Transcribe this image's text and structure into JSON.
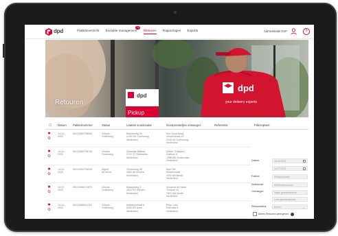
{
  "nav": {
    "logo_text": "dpd",
    "items": [
      {
        "label": "Pakketoverzicht",
        "active": false
      },
      {
        "label": "Exceptie management",
        "active": false,
        "badge": "12"
      },
      {
        "label": "Retouren",
        "active": true
      },
      {
        "label": "Rapportages",
        "active": false
      },
      {
        "label": "Exports",
        "active": false
      }
    ],
    "user": "Administratie DVP",
    "help": "?"
  },
  "hero": {
    "title": "Retouren",
    "shirt_brand": "dpd",
    "shirt_slogan": "your delivery experts",
    "shop_sign": "dpd",
    "shop_sign_sub": "Pickup"
  },
  "table": {
    "columns": [
      "Datum",
      "Pakketnummer",
      "Status",
      "Laatste scanlocatie",
      "Oorspronkelijke ontvanger",
      "Referentie"
    ],
    "rows": [
      {
        "datum": "14-01-\n2020",
        "pakket": "05123089738854",
        "status": "Ontvan\nOnderweg",
        "scan": "Bakkerweg 25\n4105 NH Culemborg\nNederland",
        "ontvanger": "Kim Gevenberg\nVlinderstraat 23\n4105 NL Culemborg\nNederland",
        "referentie": ""
      },
      {
        "datum": "14-01-\n2020",
        "pakket": "05123089738705",
        "status": "Ontvan\nOnderweg",
        "scan": "Zwaantje Bijlsma\n3712 ST Rotterdam\nNederland",
        "ontvanger": "Esther Tresbijker\nDuifhuis 6\n1388 MK Amsterdam\nNederland",
        "referentie": ""
      },
      {
        "datum": "14-01-\n2020",
        "pakket": "05123094796325",
        "status": "Afgele\nbij retour",
        "scan": "Vlinderweg 35\n3452 AB Almere\nNederland",
        "ontvanger": "Boef Vel\nMulderstraat\n4002 AB Breda\nNederland",
        "referentie": ""
      },
      {
        "datum": "14-01-\n2020",
        "pakket": "05123098274879",
        "status": "Ontvan\nOnderweg",
        "scan": "Klaasjeweg 3\n4302 KX Vlijmen\nNederland",
        "ontvanger": "Suzanne de Haan\nTuinpad 24\n7821 DA Zwolle\nNederland",
        "referentie": ""
      },
      {
        "datum": "14-01-\n2020",
        "pakket": "05123086541152",
        "status": "Ontvan\nOnderweg",
        "scan": "Kastanjestraat 8\n5400 BS Uden\nNederland",
        "ontvanger": "Peter Lam\nDriehoek 8\nNederland",
        "referentie": ""
      }
    ]
  },
  "filter": {
    "title": "Filteropties",
    "fields": [
      {
        "label": "Datum",
        "value": "16-06-2022",
        "icon": "calendar-icon"
      },
      {
        "label": "",
        "value": "16-07-2022",
        "icon": "calendar-icon"
      },
      {
        "label": "Pakket",
        "value": "Pakketnummer",
        "icon": ""
      },
      {
        "label": "Referentie",
        "value": "Referentienummer",
        "icon": ""
      },
      {
        "label": "Ontvanger",
        "value": "Naam geadresseerde",
        "icon": ""
      },
      {
        "label": "",
        "value": "Land geadresseerde",
        "icon": ""
      },
      {
        "label": "Retourstatus",
        "value": "Kiezen",
        "icon": "chevron-down-icon"
      }
    ],
    "checkbox_label": "Alleen Retouren weergeven"
  },
  "colors": {
    "brand_red": "#dc0032",
    "text_dark": "#414042",
    "text_grey": "#808285",
    "tablet_bezel": "#1b1b1d"
  }
}
